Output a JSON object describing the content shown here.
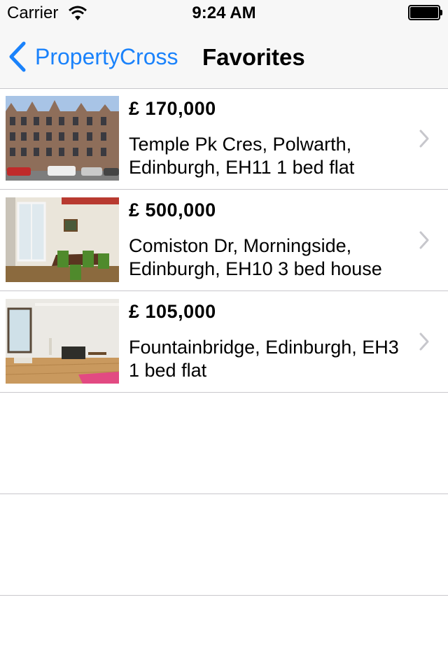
{
  "status_bar": {
    "carrier": "Carrier",
    "time": "9:24 AM"
  },
  "nav_bar": {
    "back_label": "PropertyCross",
    "title": "Favorites",
    "accent_color": "#1a82fb"
  },
  "favorites": [
    {
      "price": "£ 170,000",
      "address": "Temple Pk Cres, Polwarth, Edinburgh, EH11 1 bed flat",
      "photo": "tenement-street-exterior"
    },
    {
      "price": "£ 500,000",
      "address": "Comiston Dr, Morningside, Edinburgh, EH10 3 bed house",
      "photo": "dining-room-interior"
    },
    {
      "price": "£ 105,000",
      "address": "Fountainbridge, Edinburgh, EH3 1 bed flat",
      "photo": "living-room-interior"
    }
  ]
}
